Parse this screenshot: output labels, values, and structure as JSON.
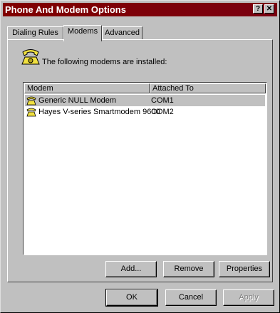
{
  "window": {
    "title": "Phone And Modem Options",
    "help_glyph": "?",
    "close_glyph": "✕"
  },
  "tabs": [
    {
      "label": "Dialing Rules",
      "active": false
    },
    {
      "label": "Modems",
      "active": true
    },
    {
      "label": "Advanced",
      "active": false
    }
  ],
  "intro_text": "The following modems are  installed:",
  "table": {
    "columns": [
      "Modem",
      "Attached To"
    ],
    "rows": [
      {
        "modem": "Generic NULL Modem",
        "port": "COM1",
        "selected": true
      },
      {
        "modem": "Hayes V-series Smartmodem 9600",
        "port": "COM2",
        "selected": false
      }
    ]
  },
  "panel_buttons": {
    "add": "Add...",
    "remove": "Remove",
    "properties": "Properties"
  },
  "dialog_buttons": {
    "ok": "OK",
    "cancel": "Cancel",
    "apply": "Apply"
  },
  "colors": {
    "face": "#c0c0c0",
    "titlebar": "#800000",
    "selection": "#c0c0c0"
  },
  "icons": {
    "intro": "telephone-icon",
    "row": "modem-phone-icon"
  }
}
